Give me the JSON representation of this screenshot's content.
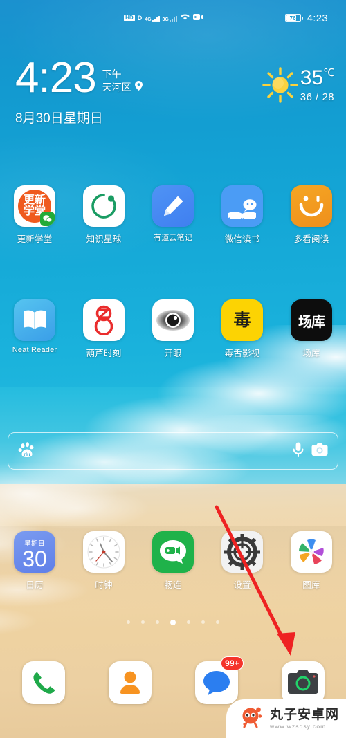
{
  "statusbar": {
    "hd_label": "HD",
    "volte_label": "D",
    "sim1_gen": "4G",
    "sim2_gen": "3G",
    "wifi_icon": "wifi-icon",
    "recording_icon": "video-recording-icon",
    "battery_percent": "76",
    "battery_level": 76,
    "clock": "4:23"
  },
  "widget": {
    "time": "4:23",
    "ampm": "下午",
    "location": "天河区",
    "location_icon": "location-pin-icon",
    "date": "8月30日星期日",
    "weather_icon": "sun-icon",
    "temperature": "35",
    "temp_unit": "℃",
    "high_low": "36 / 28"
  },
  "rows": [
    {
      "id": "row1",
      "apps": [
        {
          "label": "更新学堂",
          "icon": "gengxin-xuetang-icon",
          "badge": "wechat-badge",
          "glyph_top": "更新",
          "glyph_bottom": "学堂"
        },
        {
          "label": "知识星球",
          "icon": "zhishi-xingqiu-icon"
        },
        {
          "label": "有道云笔记",
          "icon": "youdao-yunbiji-icon"
        },
        {
          "label": "微信读书",
          "icon": "weixin-dushu-icon"
        },
        {
          "label": "多看阅读",
          "icon": "duokan-yuedu-icon"
        }
      ]
    },
    {
      "id": "row2",
      "apps": [
        {
          "label": "Neat Reader",
          "icon": "neat-reader-icon"
        },
        {
          "label": "葫芦时刻",
          "icon": "hulu-shike-icon"
        },
        {
          "label": "开眼",
          "icon": "kaiyan-icon"
        },
        {
          "label": "毒舌影视",
          "icon": "dushe-yingshi-icon",
          "glyph": "毒"
        },
        {
          "label": "场库",
          "icon": "changku-icon",
          "glyph": "场库"
        }
      ]
    },
    {
      "id": "row3",
      "apps": [
        {
          "label": "日历",
          "icon": "calendar-icon",
          "weekday": "星期日",
          "day": "30"
        },
        {
          "label": "时钟",
          "icon": "clock-icon"
        },
        {
          "label": "畅连",
          "icon": "changlian-icon"
        },
        {
          "label": "设置",
          "icon": "settings-gear-icon"
        },
        {
          "label": "图库",
          "icon": "gallery-icon"
        }
      ]
    }
  ],
  "search": {
    "engine_icon": "baidu-paw-icon",
    "placeholder": "",
    "value": "",
    "mic_icon": "microphone-icon",
    "camera_icon": "camera-search-icon"
  },
  "pager": {
    "total": 7,
    "active_index": 3
  },
  "dock": [
    {
      "label": "phone",
      "icon": "phone-icon"
    },
    {
      "label": "contacts",
      "icon": "contacts-person-icon"
    },
    {
      "label": "messages",
      "icon": "messages-bubble-icon",
      "badge": "99+"
    },
    {
      "label": "camera",
      "icon": "camera-icon"
    }
  ],
  "annotation": {
    "type": "red-arrow",
    "color": "#ee2222",
    "points_at": "camera-icon"
  },
  "watermark": {
    "name": "丸子安卓网",
    "url": "www.wzsqsy.com",
    "logo": "wanzi-mascot-icon"
  },
  "colors": {
    "ocean": "#17a6d4",
    "sand": "#efd6a8",
    "accent_red": "#ee2222",
    "badge_red": "#f5342b",
    "wechat_green": "#23ab38"
  }
}
